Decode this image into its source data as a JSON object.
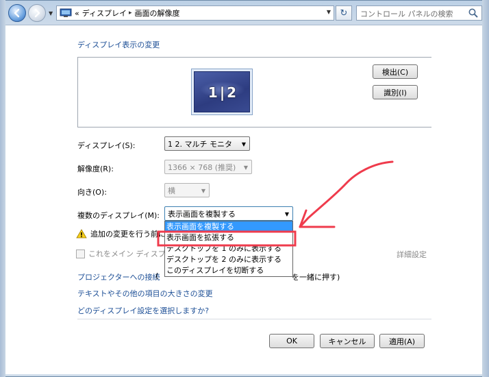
{
  "nav": {
    "address_prefix": "«",
    "breadcrumb_1": "ディスプレイ",
    "breadcrumb_sep": "▸",
    "breadcrumb_2": "画面の解像度",
    "search_placeholder": "コントロール パネルの検索",
    "refresh_glyph": "↻"
  },
  "page": {
    "heading": "ディスプレイ表示の変更",
    "monitor_label": "1|2",
    "detect_button": "検出(C)",
    "identify_button": "識別(I)"
  },
  "form": {
    "display_label": "ディスプレイ(S):",
    "display_value": "1 2. マルチ モニタ",
    "resolution_label": "解像度(R):",
    "resolution_value": "1366 × 768 (推奨)",
    "orientation_label": "向き(O):",
    "orientation_value": "横",
    "multi_label": "複数のディスプレイ(M):",
    "multi_value": "表示画面を複製する"
  },
  "dropdown": {
    "options": [
      "表示画面を複製する",
      "表示画面を拡張する",
      "デスクトップを 1 のみに表示する",
      "デスクトップを 2 のみに表示する",
      "このディスプレイを切断する"
    ],
    "selected_index": 0,
    "highlighted_index": 1
  },
  "warning": {
    "text": "追加の変更を行う前に"
  },
  "main_display": {
    "text": "これをメイン ディスプ",
    "advanced_link": "詳細設定"
  },
  "links": {
    "projector": "プロジェクターへの接続",
    "projector_paren": "(",
    "projector_suffix": "を一緒に押す)",
    "text_size": "テキストやその他の項目の大きさの変更",
    "which_setting": "どのディスプレイ設定を選択しますか?"
  },
  "buttons": {
    "ok": "OK",
    "cancel": "キャンセル",
    "apply": "適用(A)"
  },
  "colors": {
    "link": "#1d4f96",
    "annotation_red": "#ef3b4c",
    "selection_blue": "#3399ff"
  }
}
